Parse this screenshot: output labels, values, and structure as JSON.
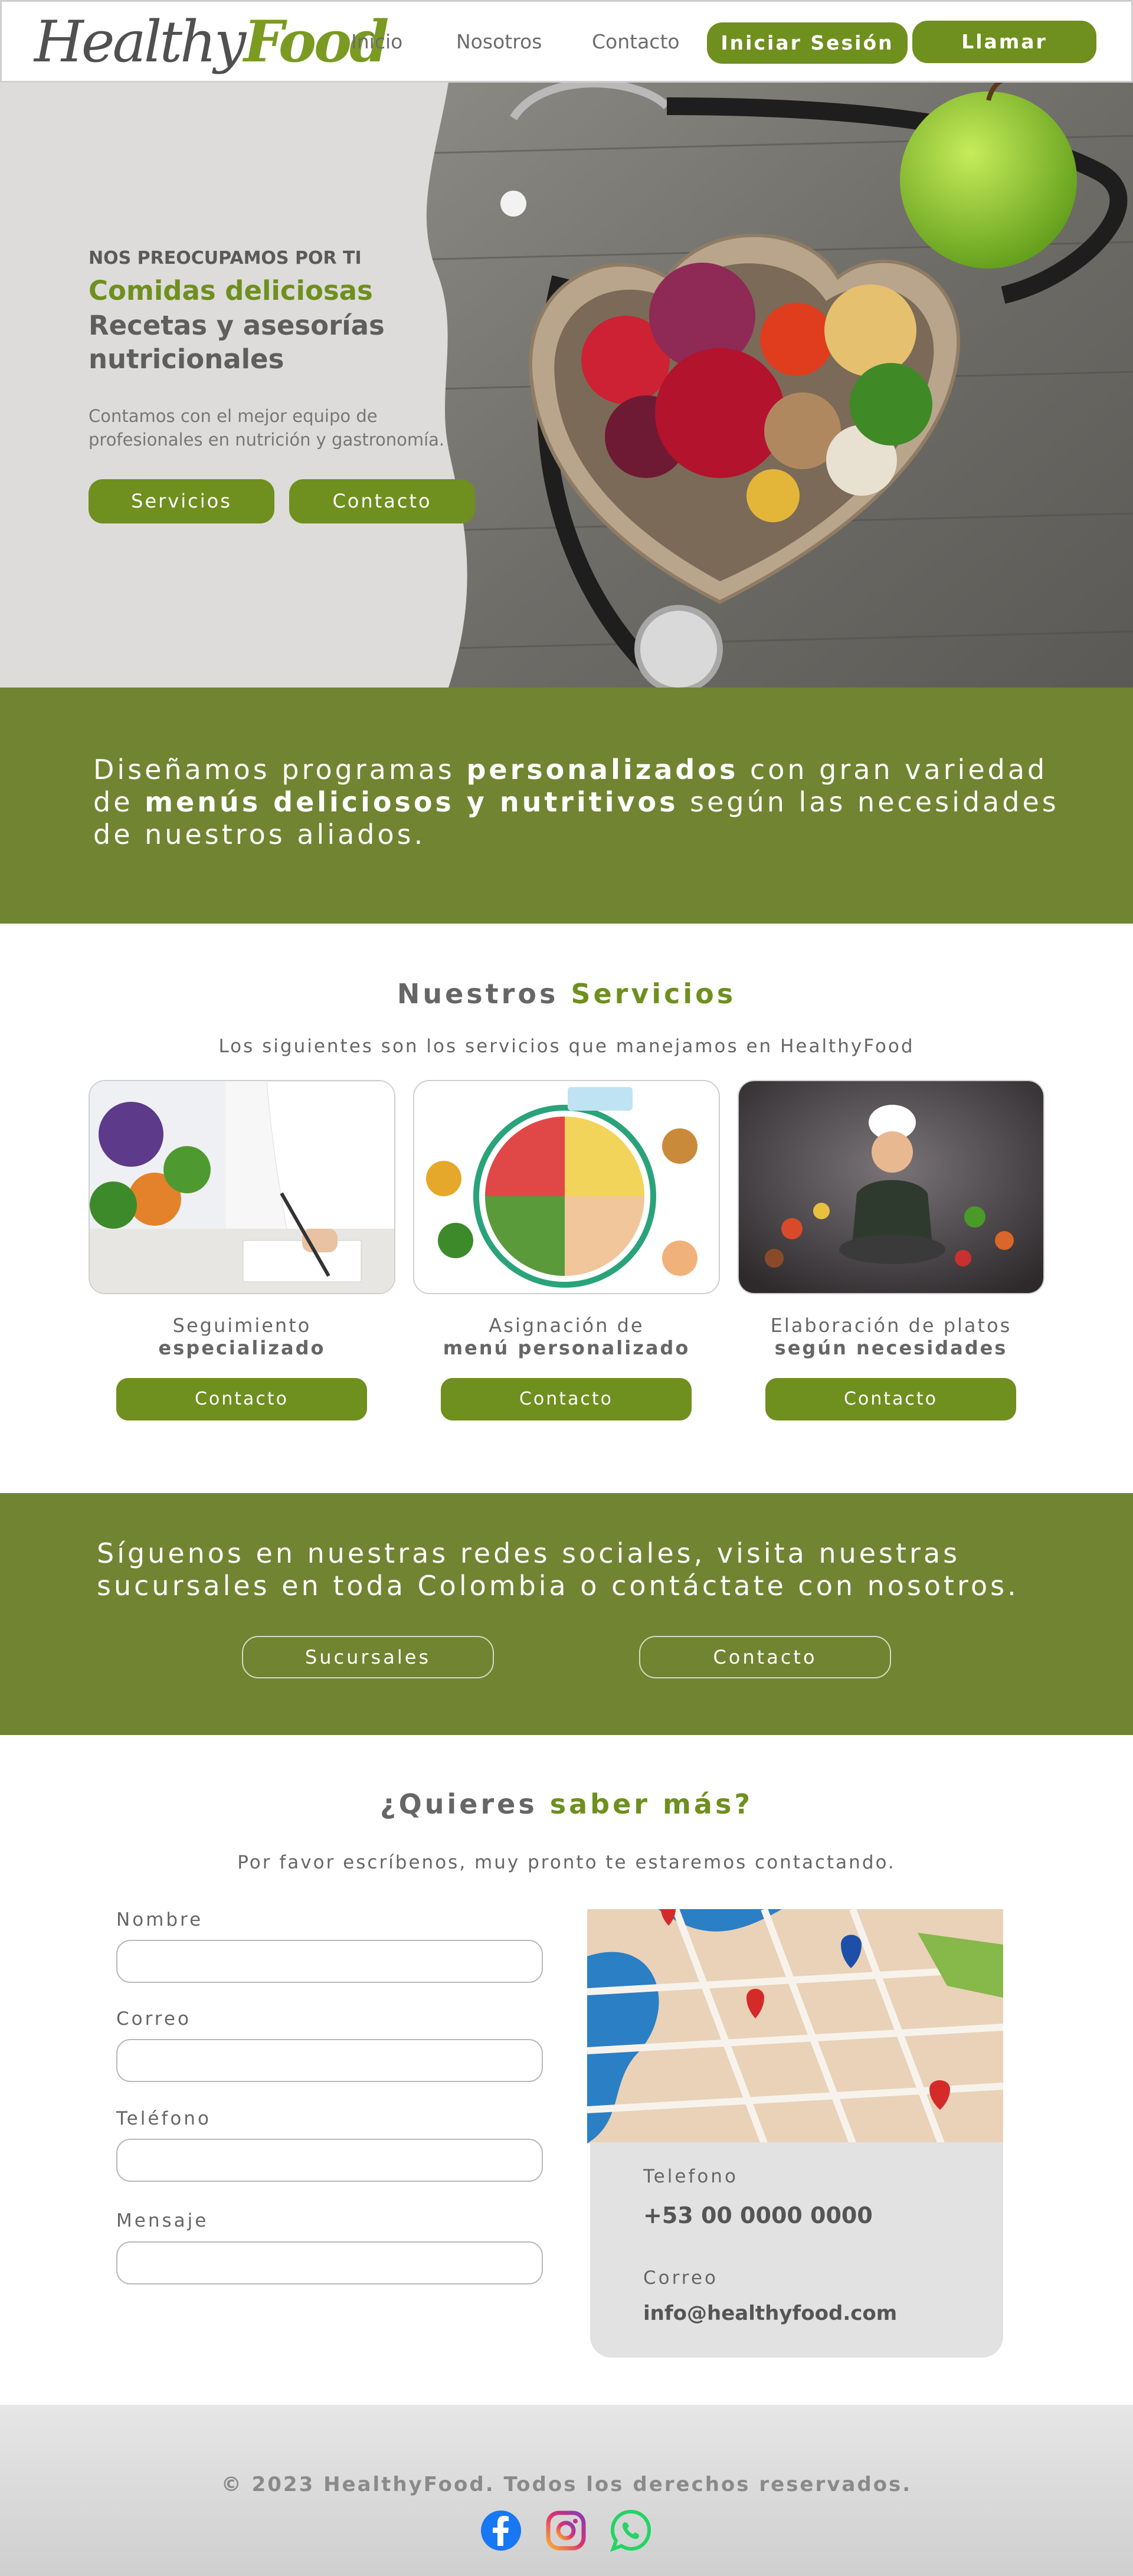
{
  "brand": {
    "logo_part1": "Healthy",
    "logo_part2": "Food"
  },
  "nav": {
    "links": [
      "Inicio",
      "Nosotros",
      "Contacto"
    ],
    "login_label": "Iniciar Sesión",
    "call_label": "Llamar"
  },
  "hero": {
    "kicker": "NOS PREOCUPAMOS POR TI",
    "title_green": "Comidas deliciosas",
    "title_gray": "Recetas y asesorías nutricionales",
    "description": "Contamos con el mejor equipo de profesionales en nutrición y gastronomía.",
    "buttons": [
      "Servicios",
      "Contacto"
    ]
  },
  "banner1": {
    "p1": "Diseñamos programas ",
    "b1": "personalizados",
    "p2": " con gran variedad de ",
    "b2": "menús deliciosos y nutritivos",
    "p3": " según las necesidades de nuestros aliados."
  },
  "services": {
    "title_a": "Nuestros",
    "title_b": "Servicios",
    "subtitle": "Los siguientes son los servicios que manejamos en HealthyFood",
    "cards": [
      {
        "line1": "Seguimiento",
        "line2": "especializado",
        "button": "Contacto"
      },
      {
        "line1": "Asignación de",
        "line2": "menú personalizado",
        "button": "Contacto"
      },
      {
        "line1": "Elaboración de platos",
        "line2": "según necesidades",
        "button": "Contacto"
      }
    ]
  },
  "banner2": {
    "text": "Síguenos en nuestras redes sociales, visita nuestras sucursales en toda Colombia o contáctate con nosotros.",
    "buttons": [
      "Sucursales",
      "Contacto"
    ]
  },
  "contact": {
    "title_a": "¿Quieres",
    "title_b": "saber más?",
    "subtitle": "Por favor escríbenos, muy pronto te estaremos contactando.",
    "fields": [
      {
        "label": "Nombre",
        "value": ""
      },
      {
        "label": "Correo",
        "value": ""
      },
      {
        "label": "Teléfono",
        "value": ""
      },
      {
        "label": "Mensaje",
        "value": ""
      }
    ],
    "info": {
      "phone_label": "Telefono",
      "phone": "+53 00 0000 0000",
      "email_label": "Correo",
      "email": "info@healthyfood.com"
    }
  },
  "footer": {
    "copyright": "© 2023 HealthyFood. Todos los derechos reservados.",
    "social": [
      "facebook-icon",
      "instagram-icon",
      "whatsapp-icon"
    ]
  },
  "colors": {
    "brand_green": "#6f8f1f",
    "banner_green": "#718432",
    "text_gray": "#5e5e5e",
    "hero_bg": "#dddcda",
    "info_card_bg": "#e2e2e2"
  }
}
